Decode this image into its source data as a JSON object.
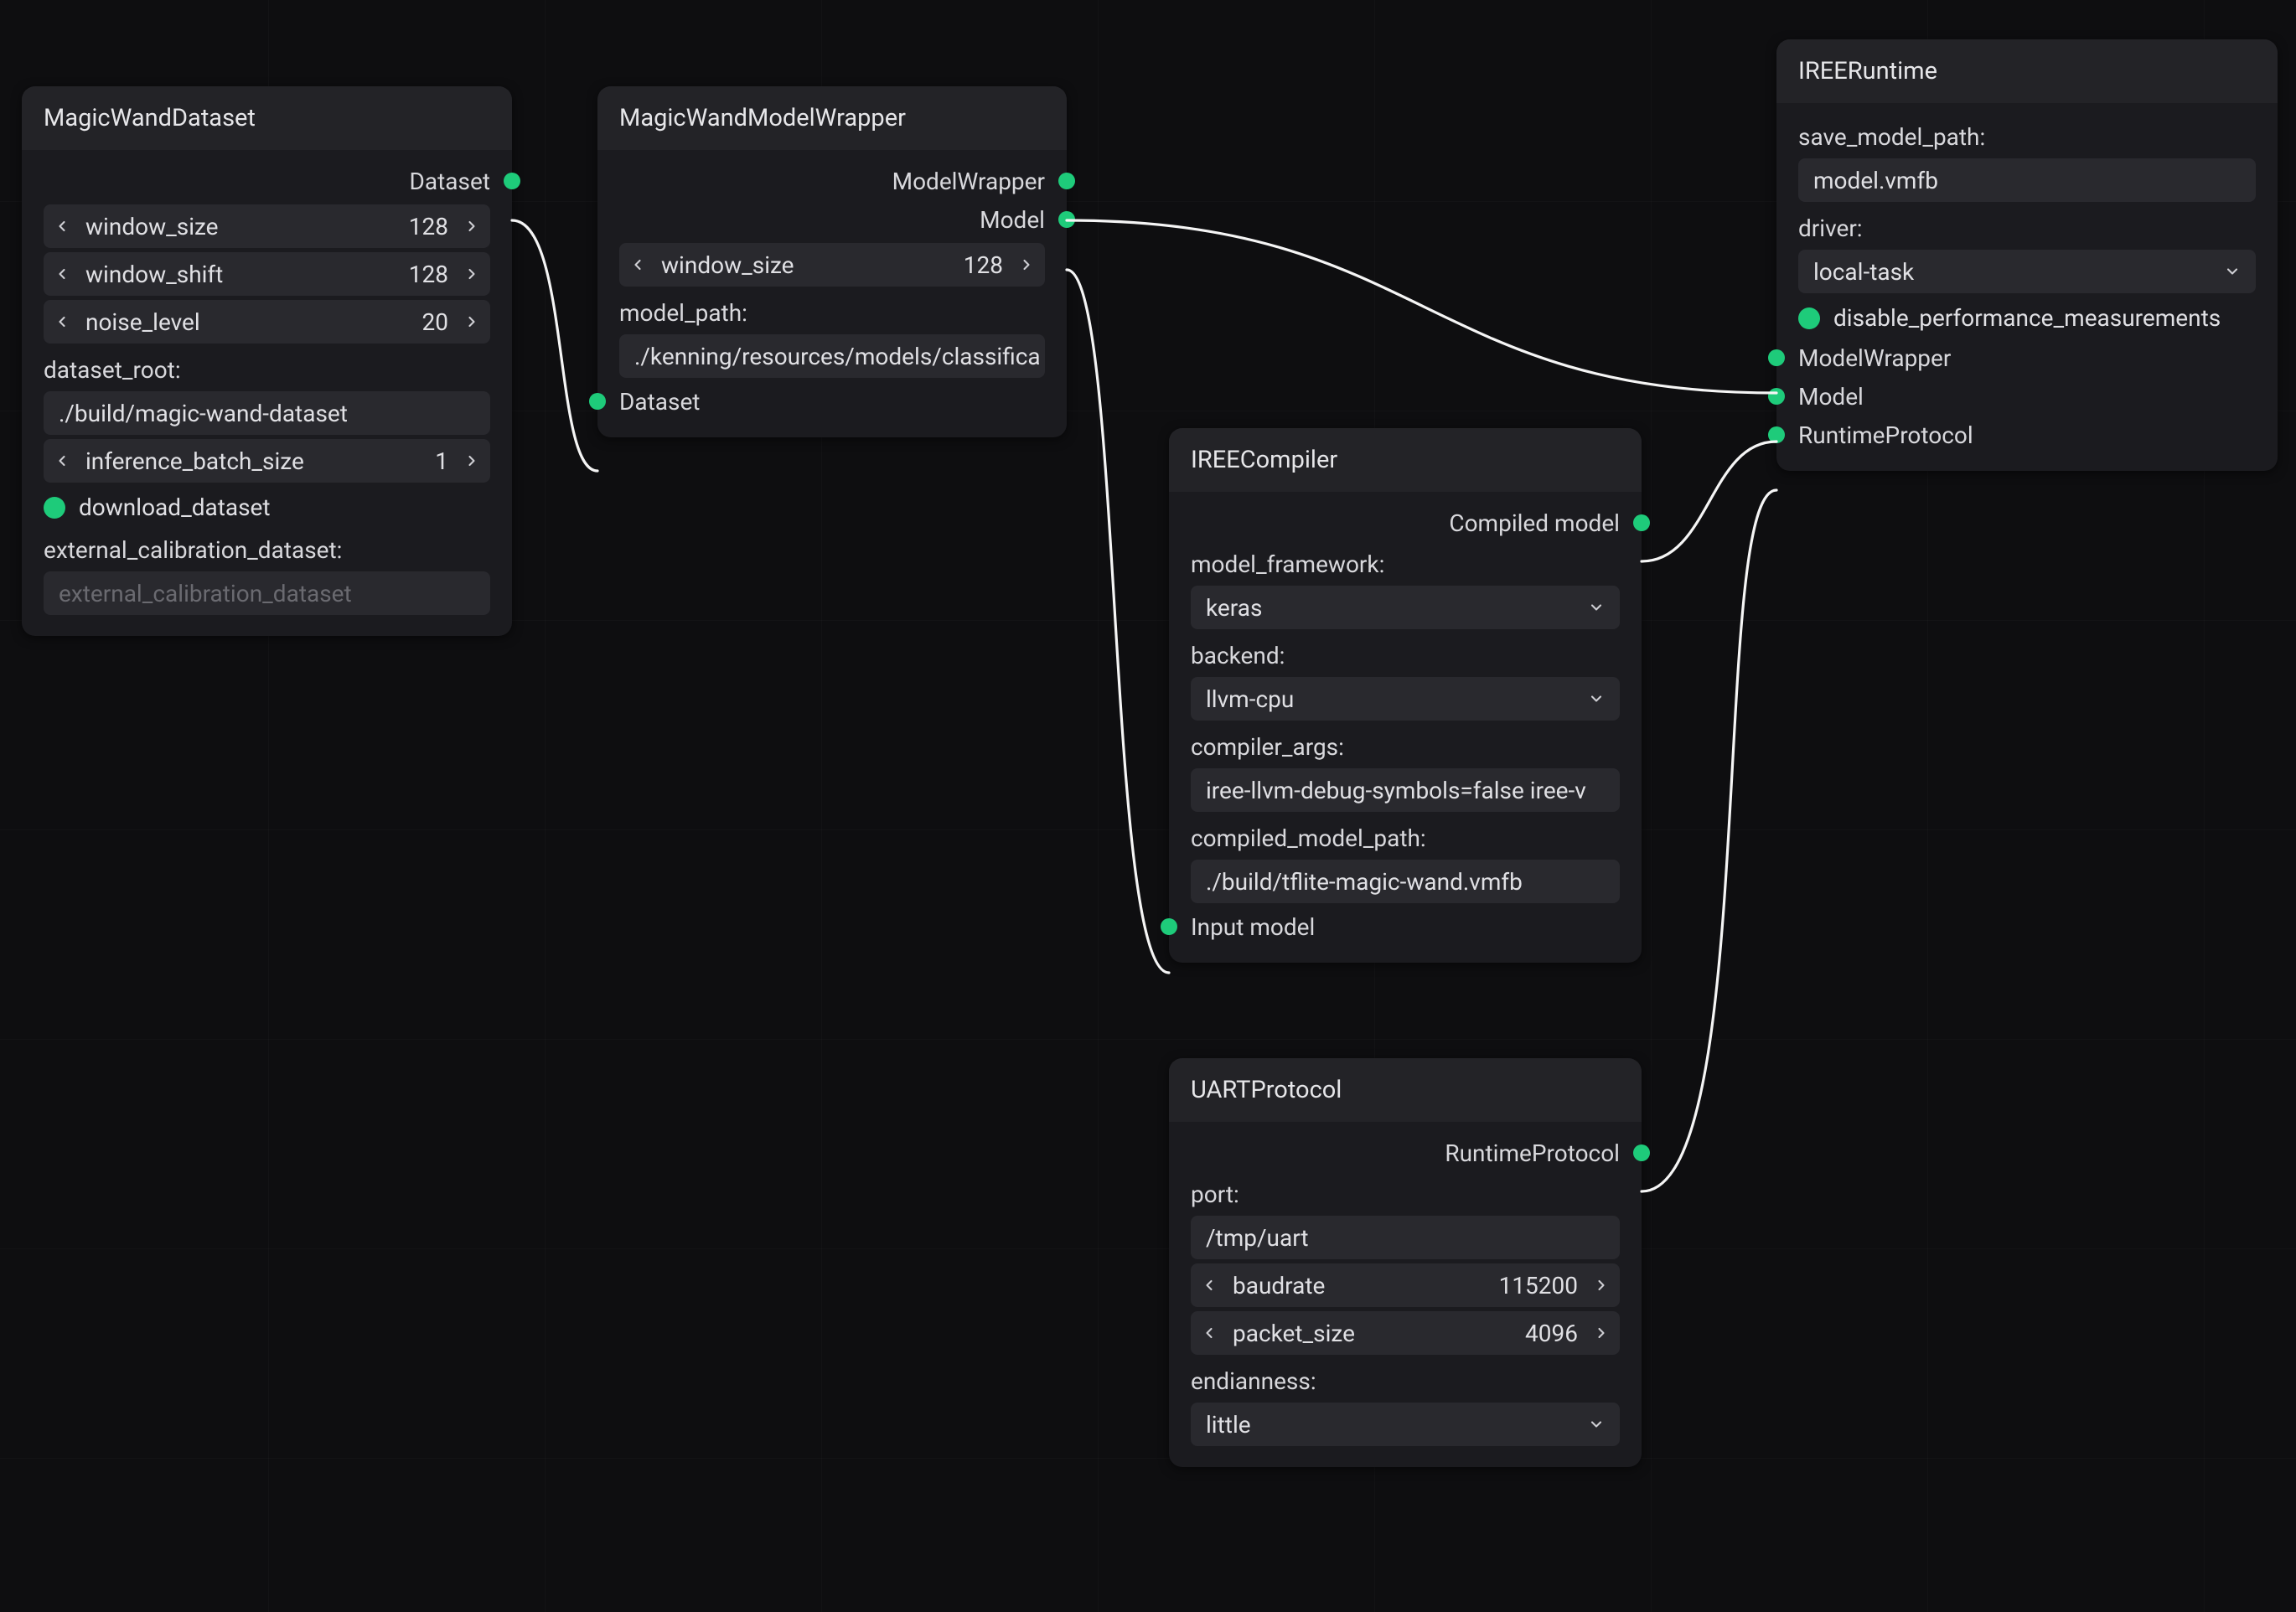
{
  "nodes": {
    "dataset": {
      "title": "MagicWandDataset",
      "outputs": {
        "dataset": "Dataset"
      },
      "fields": {
        "window_size": {
          "label": "window_size",
          "value": "128"
        },
        "window_shift": {
          "label": "window_shift",
          "value": "128"
        },
        "noise_level": {
          "label": "noise_level",
          "value": "20"
        },
        "dataset_root_label": "dataset_root:",
        "dataset_root_value": "./build/magic-wand-dataset",
        "inference_batch_size": {
          "label": "inference_batch_size",
          "value": "1"
        },
        "download_dataset_label": "download_dataset",
        "external_calib_label": "external_calibration_dataset:",
        "external_calib_placeholder": "external_calibration_dataset"
      }
    },
    "wrapper": {
      "title": "MagicWandModelWrapper",
      "outputs": {
        "modelwrapper": "ModelWrapper",
        "model": "Model"
      },
      "fields": {
        "window_size": {
          "label": "window_size",
          "value": "128"
        },
        "model_path_label": "model_path:",
        "model_path_value": "./kenning/resources/models/classifica"
      },
      "inputs": {
        "dataset": "Dataset"
      }
    },
    "compiler": {
      "title": "IREECompiler",
      "outputs": {
        "compiled": "Compiled model"
      },
      "fields": {
        "model_framework_label": "model_framework:",
        "model_framework_value": "keras",
        "backend_label": "backend:",
        "backend_value": "llvm-cpu",
        "compiler_args_label": "compiler_args:",
        "compiler_args_value": "iree-llvm-debug-symbols=false iree-v",
        "compiled_model_path_label": "compiled_model_path:",
        "compiled_model_path_value": "./build/tflite-magic-wand.vmfb"
      },
      "inputs": {
        "input_model": "Input model"
      }
    },
    "uart": {
      "title": "UARTProtocol",
      "outputs": {
        "runtime_protocol": "RuntimeProtocol"
      },
      "fields": {
        "port_label": "port:",
        "port_value": "/tmp/uart",
        "baudrate": {
          "label": "baudrate",
          "value": "115200"
        },
        "packet_size": {
          "label": "packet_size",
          "value": "4096"
        },
        "endianness_label": "endianness:",
        "endianness_value": "little"
      }
    },
    "runtime": {
      "title": "IREERuntime",
      "fields": {
        "save_model_path_label": "save_model_path:",
        "save_model_path_value": "model.vmfb",
        "driver_label": "driver:",
        "driver_value": "local-task",
        "disable_perf_label": "disable_performance_measurements"
      },
      "inputs": {
        "modelwrapper": "ModelWrapper",
        "model": "Model",
        "runtime_protocol": "RuntimeProtocol"
      }
    }
  }
}
